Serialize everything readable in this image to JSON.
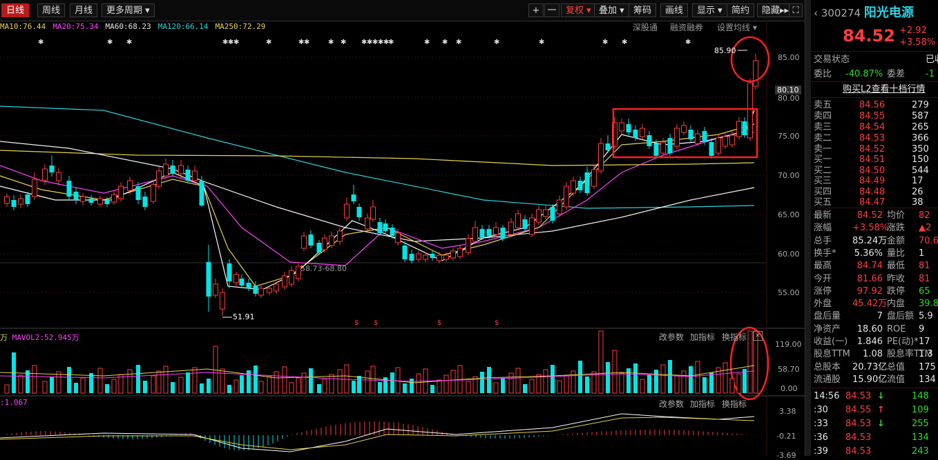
{
  "toolbar": {
    "periods": [
      "日线",
      "周线",
      "月线",
      "更多周期"
    ],
    "right_buttons": [
      "+",
      "一",
      "复权",
      "叠加",
      "筹码",
      "画线",
      "显示",
      "简约",
      "隐藏"
    ]
  },
  "ma_bar": {
    "ma10": "MA10:76.44",
    "ma20": "MA20:75.34",
    "ma60": "MA60:68.23",
    "ma120": "MA120:66.14",
    "ma250": "MA250:72.29",
    "links": [
      "深股通",
      "融资融券",
      "设置均线"
    ]
  },
  "chart_labels": {
    "high_label": "85.90",
    "low_label": "51.91",
    "range_label": "58.73-68.80",
    "price_axis": [
      "85.00",
      "80.10",
      "80.00",
      "75.00",
      "70.00",
      "65.00",
      "60.00",
      "55.00"
    ],
    "vol_title_a": "万",
    "vol_title_b": "MAVOL2:52.945万",
    "vol_axis": [
      "119.00",
      "58.70",
      "0.00"
    ],
    "macd_title": ":1.067",
    "macd_axis": [
      "3.38",
      "-0.21",
      "-3.69"
    ],
    "panel_links": [
      "改参数",
      "加指标",
      "换指标"
    ]
  },
  "colors": {
    "up": "#ff3c3c",
    "down": "#00e5e5",
    "ma5": "#ffffff",
    "ma10": "#e8d44d",
    "ma20": "#ff40ff",
    "ma60": "#2bdc2b",
    "ma120": "#5aa0ff"
  },
  "quote": {
    "code": "300274",
    "name": "阳光电源",
    "price": "84.52",
    "change": "+2.92",
    "pct": "+3.58%",
    "status_label": "交易状态",
    "status_val": "已收",
    "wb_label": "委比",
    "wb_val": "-40.87%",
    "wc_label": "委差",
    "wc_val": "-1",
    "l2": "购买L2查看十档行情",
    "asks": [
      {
        "label": "卖五",
        "price": "84.56",
        "vol": "279"
      },
      {
        "label": "卖四",
        "price": "84.55",
        "vol": "587"
      },
      {
        "label": "卖三",
        "price": "84.54",
        "vol": "265"
      },
      {
        "label": "卖二",
        "price": "84.53",
        "vol": "366"
      },
      {
        "label": "卖一",
        "price": "84.52",
        "vol": "350"
      }
    ],
    "bids": [
      {
        "label": "买一",
        "price": "84.51",
        "vol": "150"
      },
      {
        "label": "买二",
        "price": "84.50",
        "vol": "544"
      },
      {
        "label": "买三",
        "price": "84.49",
        "vol": "17"
      },
      {
        "label": "买四",
        "price": "84.48",
        "vol": "26"
      },
      {
        "label": "买五",
        "price": "84.47",
        "vol": "38"
      }
    ],
    "stats": [
      [
        "最新",
        "84.52",
        "均价",
        "82"
      ],
      [
        "涨幅",
        "+3.58%",
        "涨跌",
        "▲2"
      ],
      [
        "总手",
        "85.24万",
        "金额",
        "70.6"
      ],
      [
        "换手*",
        "5.36%",
        "量比",
        "1"
      ],
      [
        "最高",
        "84.74",
        "最低",
        "81"
      ],
      [
        "今开",
        "81.66",
        "昨收",
        "81"
      ],
      [
        "涨停",
        "97.92",
        "跌停",
        "65"
      ],
      [
        "外盘",
        "45.42万",
        "内盘",
        "39.8"
      ],
      [
        "盘后量",
        "7",
        "盘后额",
        "5.9"
      ],
      [
        "净资产",
        "18.60",
        "ROE",
        "9"
      ],
      [
        "收益(一)",
        "1.846",
        "PE(动)*",
        "17"
      ],
      [
        "股息TTM",
        "1.08",
        "股息率TTM",
        "1.3"
      ],
      [
        "总股本",
        "20.73亿",
        "总值",
        "175"
      ],
      [
        "流通股",
        "15.90亿",
        "流值",
        "134"
      ]
    ],
    "ticks": [
      [
        "14:56",
        "84.53",
        "↓",
        "148"
      ],
      [
        ":30",
        "84.55",
        "↑",
        "109"
      ],
      [
        ":33",
        "84.53",
        "↓",
        "255"
      ],
      [
        ":36",
        "84.53",
        "",
        "134"
      ],
      [
        ":39",
        "84.53",
        "",
        "243"
      ]
    ]
  }
}
